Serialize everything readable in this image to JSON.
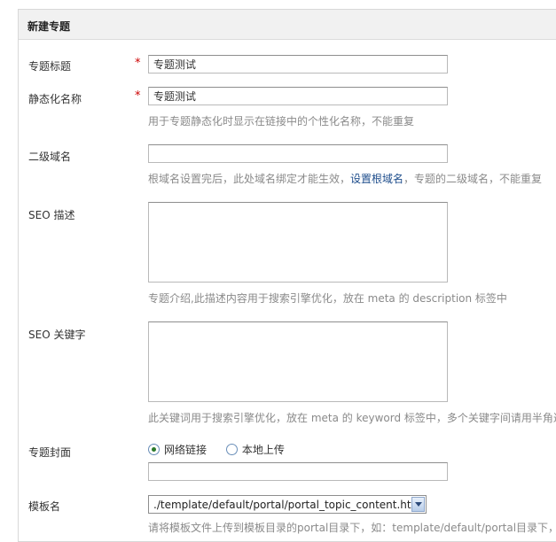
{
  "panel": {
    "title": "新建专题"
  },
  "fields": {
    "title": {
      "label": "专题标题",
      "required_mark": "*",
      "value": "专题测试"
    },
    "static_name": {
      "label": "静态化名称",
      "required_mark": "*",
      "value": "专题测试",
      "hint": "用于专题静态化时显示在链接中的个性化名称，不能重复"
    },
    "subdomain": {
      "label": "二级域名",
      "value": "",
      "hint_before": "根域名设置完后，此处域名绑定才能生效，",
      "hint_link": "设置根域名",
      "hint_after": "，专题的二级域名，不能重复"
    },
    "seo_description": {
      "label": "SEO 描述",
      "value": "",
      "hint": "专题介绍,此描述内容用于搜索引擎优化，放在 meta 的 description 标签中"
    },
    "seo_keywords": {
      "label": "SEO 关键字",
      "value": "",
      "hint": "此关键词用于搜索引擎优化，放在 meta 的 keyword 标签中，多个关键字间请用半角逗"
    },
    "cover": {
      "label": "专题封面",
      "options": [
        {
          "label": "网络链接",
          "checked": true
        },
        {
          "label": "本地上传",
          "checked": false
        }
      ],
      "value": ""
    },
    "template": {
      "label": "模板名",
      "selected": "./template/default/portal/portal_topic_content.htm",
      "hint": "请将模板文件上传到模板目录的portal目录下，如：template/default/portal目录下，文"
    }
  }
}
